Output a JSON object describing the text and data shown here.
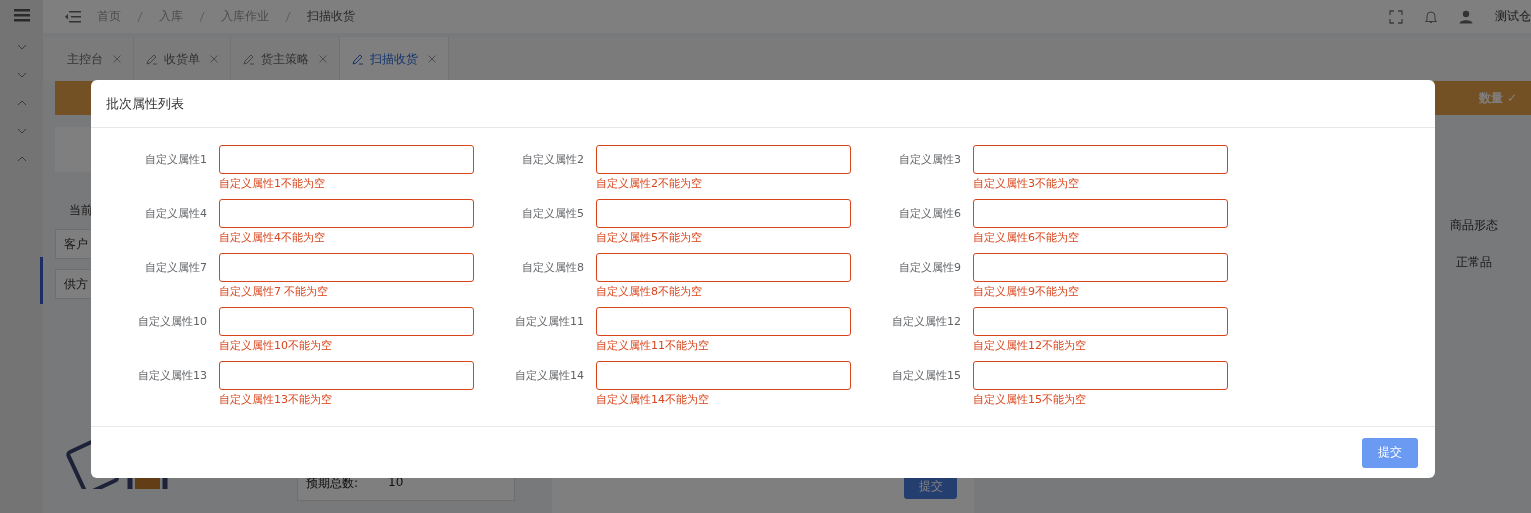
{
  "header": {
    "breadcrumb": [
      "首页",
      "入库",
      "入库作业",
      "扫描收货"
    ],
    "user": "测试仓"
  },
  "tabs": [
    {
      "label": "主控台",
      "icon": false,
      "selected": false
    },
    {
      "label": "收货单",
      "icon": true,
      "selected": false
    },
    {
      "label": "货主策略",
      "icon": true,
      "selected": false
    },
    {
      "label": "扫描收货",
      "icon": true,
      "selected": true
    }
  ],
  "banner": {
    "right": "数量 ✓"
  },
  "page": {
    "current_label": "当前",
    "field_labels": [
      "客户",
      "供方"
    ],
    "table_header": "商品形态",
    "table_cell": "正常品",
    "expected_label": "预期总数:",
    "expected_value": "10",
    "submit": "提交"
  },
  "dialog": {
    "title": "批次属性列表",
    "submit": "提交",
    "fields": [
      {
        "label": "自定义属性1",
        "error": "自定义属性1不能为空",
        "invalid": true
      },
      {
        "label": "自定义属性2",
        "error": "自定义属性2不能为空",
        "invalid": true
      },
      {
        "label": "自定义属性3",
        "error": "自定义属性3不能为空",
        "invalid": true
      },
      {
        "label": "自定义属性4",
        "error": "自定义属性4不能为空",
        "invalid": true
      },
      {
        "label": "自定义属性5",
        "error": "自定义属性5不能为空",
        "invalid": true
      },
      {
        "label": "自定义属性6",
        "error": "自定义属性6不能为空",
        "invalid": true
      },
      {
        "label": "自定义属性7",
        "error": "自定义属性7 不能为空",
        "invalid": true
      },
      {
        "label": "自定义属性8",
        "error": "自定义属性8不能为空",
        "invalid": true
      },
      {
        "label": "自定义属性9",
        "error": "自定义属性9不能为空",
        "invalid": true
      },
      {
        "label": "自定义属性10",
        "error": "自定义属性10不能为空",
        "invalid": true
      },
      {
        "label": "自定义属性11",
        "error": "自定义属性11不能为空",
        "invalid": true
      },
      {
        "label": "自定义属性12",
        "error": "自定义属性12不能为空",
        "invalid": true
      },
      {
        "label": "自定义属性13",
        "error": "自定义属性13不能为空",
        "invalid": true
      },
      {
        "label": "自定义属性14",
        "error": "自定义属性14不能为空",
        "invalid": true
      },
      {
        "label": "自定义属性15",
        "error": "自定义属性15不能为空",
        "invalid": true
      }
    ]
  }
}
